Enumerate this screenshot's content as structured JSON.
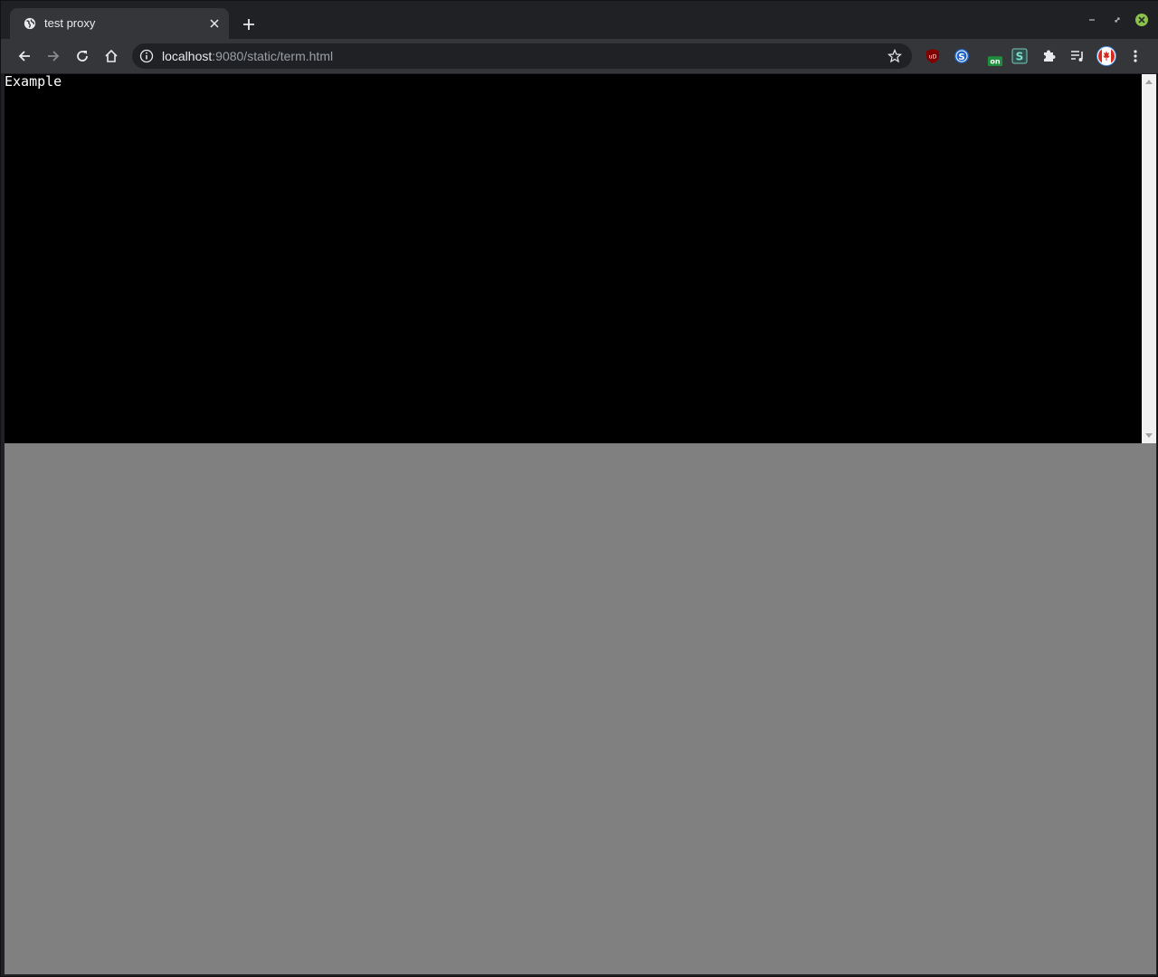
{
  "tab": {
    "title": "test proxy"
  },
  "address_bar": {
    "host": "localhost",
    "rest": ":9080/static/term.html"
  },
  "extensions": {
    "ublock_label": "uD",
    "badge_on": "on",
    "s_letter": "S"
  },
  "terminal": {
    "text": "Example"
  },
  "colors": {
    "chrome_dark": "#202124",
    "toolbar": "#35363a",
    "terminal_bg": "#000000",
    "page_bg": "#808080",
    "win_close": "#8bc34a"
  }
}
